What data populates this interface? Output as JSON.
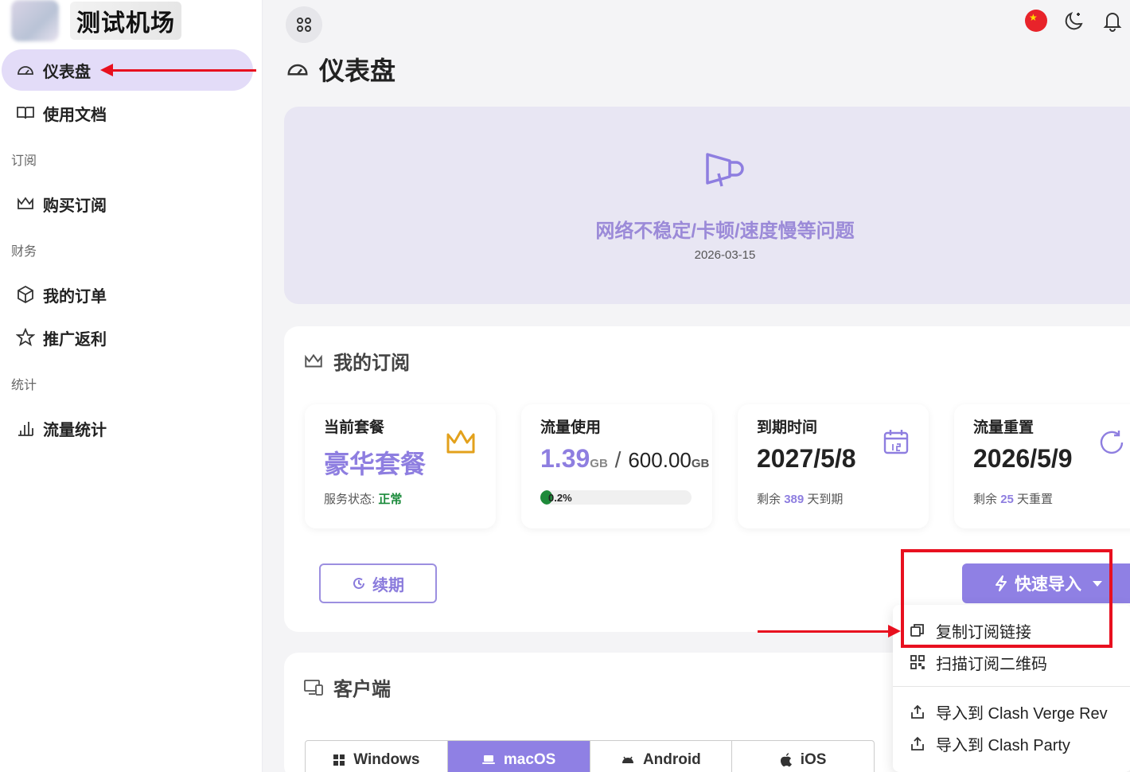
{
  "brand": {
    "name": "测试机场"
  },
  "sidebar": {
    "items": [
      {
        "label": "仪表盘",
        "icon": "dashboard-icon"
      },
      {
        "label": "使用文档",
        "icon": "book-icon"
      },
      {
        "section": "订阅"
      },
      {
        "label": "购买订阅",
        "icon": "crown-icon"
      },
      {
        "section": "财务"
      },
      {
        "label": "我的订单",
        "icon": "box-icon"
      },
      {
        "label": "推广返利",
        "icon": "star-icon"
      },
      {
        "section": "统计"
      },
      {
        "label": "流量统计",
        "icon": "bar-chart-icon"
      }
    ]
  },
  "header": {
    "page_title": "仪表盘"
  },
  "notice": {
    "title": "网络不稳定/卡顿/速度慢等问题",
    "date": "2026-03-15"
  },
  "subscription": {
    "title": "我的订阅",
    "plan": {
      "label": "当前套餐",
      "name": "豪华套餐",
      "status_label": "服务状态:",
      "status": "正常"
    },
    "traffic": {
      "label": "流量使用",
      "used": "1.39",
      "used_unit": "GB",
      "sep": "/",
      "total": "600.00",
      "total_unit": "GB",
      "percent_label": "0.2%",
      "percent": 0.2
    },
    "expiry": {
      "label": "到期时间",
      "date": "2027/5/8",
      "remain_prefix": "剩余",
      "remain_days": "389",
      "remain_suffix": "天到期"
    },
    "reset": {
      "label": "流量重置",
      "date": "2026/5/9",
      "remain_prefix": "剩余",
      "remain_days": "25",
      "remain_suffix": "天重置"
    },
    "renew_label": "续期",
    "import_label": "快速导入"
  },
  "dropdown": {
    "items": [
      {
        "label": "复制订阅链接",
        "icon": "copy-icon"
      },
      {
        "label": "扫描订阅二维码",
        "icon": "qr-icon"
      },
      {
        "label": "导入到 Clash Verge Rev",
        "icon": "share-icon"
      },
      {
        "label": "导入到 Clash Party",
        "icon": "share-icon"
      }
    ]
  },
  "clients": {
    "title": "客户端",
    "tabs": [
      {
        "label": "Windows",
        "active": false
      },
      {
        "label": "macOS",
        "active": true
      },
      {
        "label": "Android",
        "active": false
      },
      {
        "label": "iOS",
        "active": false
      }
    ]
  },
  "colors": {
    "accent": "#8f80e4",
    "active_nav": "#e3dcf8",
    "annotation": "#e8101f",
    "success": "#1a8a3a"
  }
}
